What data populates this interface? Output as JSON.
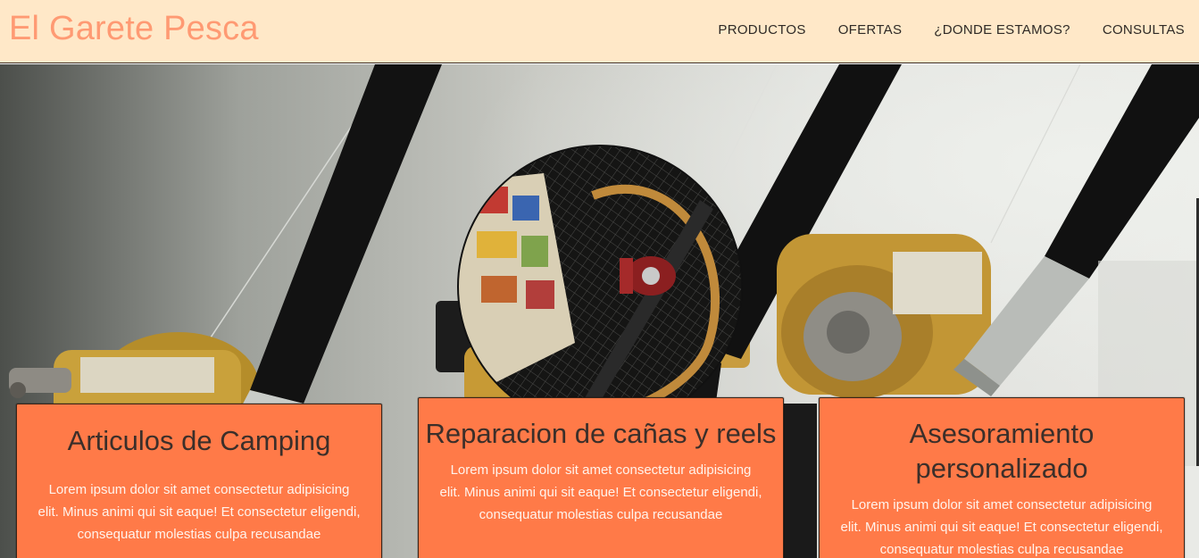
{
  "header": {
    "brand": "El Garete Pesca",
    "nav": [
      {
        "label": "PRODUCTOS"
      },
      {
        "label": "OFERTAS"
      },
      {
        "label": "¿DONDE ESTAMOS?"
      },
      {
        "label": "CONSULTAS"
      }
    ]
  },
  "hero": {
    "background_image": "fishing-rods-reels-photo",
    "badge_image": "tackle-box-net-reel-photo"
  },
  "cards": [
    {
      "title": "Articulos de Camping",
      "text": "Lorem ipsum dolor sit amet consectetur adipisicing elit. Minus animi qui sit eaque! Et consectetur eligendi, consequatur molestias culpa recusandae"
    },
    {
      "title": "Reparacion de cañas y reels",
      "text": "Lorem ipsum dolor sit amet consectetur adipisicing elit. Minus animi qui sit eaque! Et consectetur eligendi, consequatur molestias culpa recusandae"
    },
    {
      "title": "Asesoramiento personalizado",
      "text": "Lorem ipsum dolor sit amet consectetur adipisicing elit. Minus animi qui sit eaque! Et consectetur eligendi, consequatur molestias culpa recusandae"
    }
  ],
  "colors": {
    "header_bg": "#ffe8c8",
    "brand": "#ff9a73",
    "card_bg": "#ff7a48",
    "card_title": "#3b2f2a",
    "card_text": "#fff3ec"
  }
}
